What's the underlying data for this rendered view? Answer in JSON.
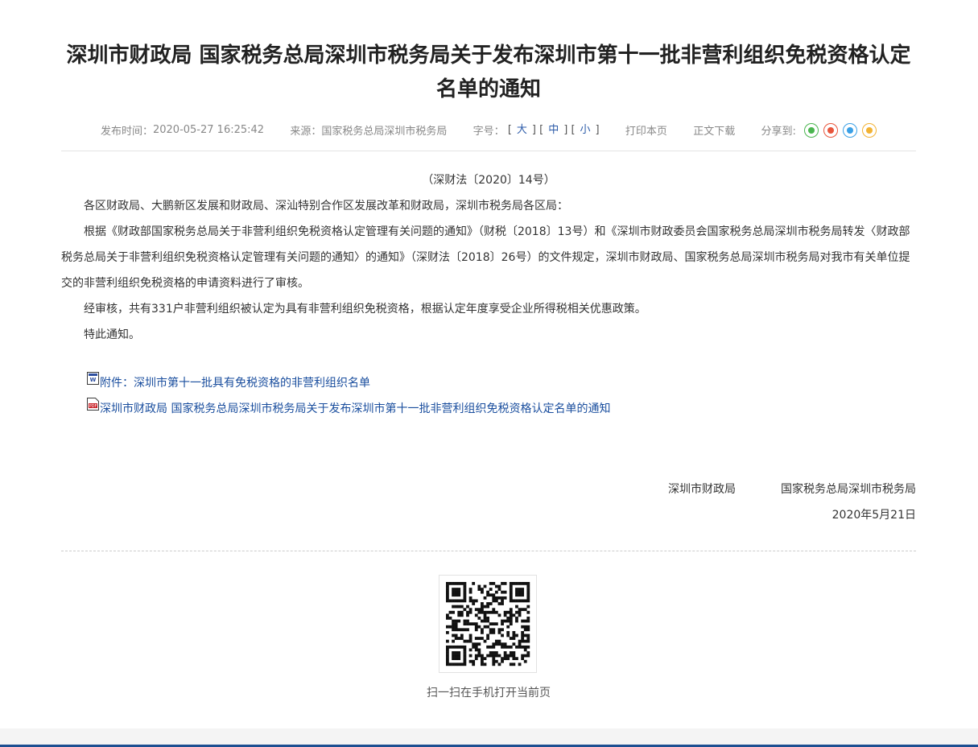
{
  "article": {
    "title": "深圳市财政局 国家税务总局深圳市税务局关于发布深圳市第十一批非营利组织免税资格认定名单的通知",
    "meta": {
      "publish_time_label": "发布时间：",
      "publish_time": "2020-05-27 16:25:42",
      "source_label": "来源：",
      "source": "国家税务总局深圳市税务局",
      "font_size_label": "字号：",
      "font_large": "大",
      "font_medium": "中",
      "font_small": "小",
      "print_label": "打印本页",
      "download_label": "正文下载",
      "share_label": "分享到:"
    },
    "doc_number": "（深财法〔2020〕14号）",
    "paragraphs": [
      "各区财政局、大鹏新区发展和财政局、深汕特别合作区发展改革和财政局，深圳市税务局各区局：",
      "根据《财政部国家税务总局关于非营利组织免税资格认定管理有关问题的通知》（财税〔2018〕13号）和《深圳市财政委员会国家税务总局深圳市税务局转发〈财政部税务总局关于非营利组织免税资格认定管理有关问题的通知〉的通知》（深财法〔2018〕26号）的文件规定，深圳市财政局、国家税务总局深圳市税务局对我市有关单位提交的非营利组织免税资格的申请资料进行了审核。",
      "经审核，共有331户非营利组织被认定为具有非营利组织免税资格，根据认定年度享受企业所得税相关优惠政策。",
      "特此通知。"
    ],
    "attachments": [
      {
        "label": "附件：深圳市第十一批具有免税资格的非营利组织名单",
        "icon": "word-file-icon"
      },
      {
        "label": "深圳市财政局 国家税务总局深圳市税务局关于发布深圳市第十一批非营利组织免税资格认定名单的通知",
        "icon": "pdf-file-icon"
      }
    ],
    "signature": {
      "org1": "深圳市财政局",
      "org2": "国家税务总局深圳市税务局",
      "date": "2020年5月21日"
    }
  },
  "qr": {
    "caption": "扫一扫在手机打开当前页"
  },
  "colors": {
    "wechat": "#4ab54f",
    "weibo": "#e8553c",
    "qq": "#3aa0e6",
    "qzone": "#f2b233",
    "link": "#1a4e9e",
    "footer": "#1d4f91"
  }
}
